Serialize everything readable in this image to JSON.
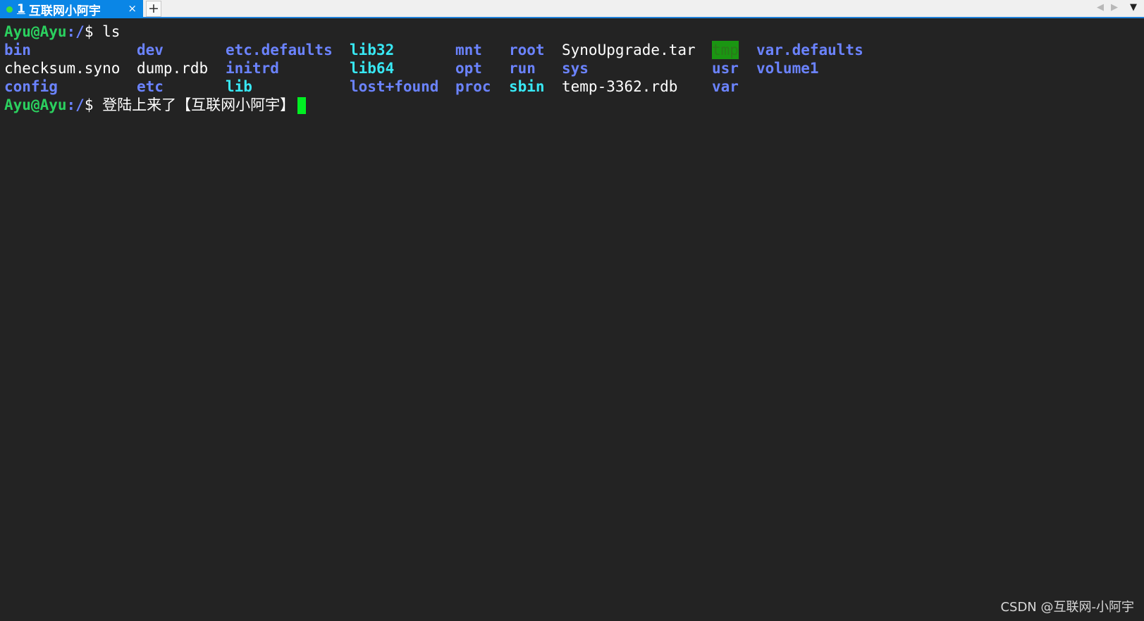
{
  "tab": {
    "number": "1",
    "title": "互联网小阿宇",
    "close_glyph": "×",
    "status_color": "#3ee03e"
  },
  "tabbar": {
    "new_tab_glyph": "+",
    "scroll_left_glyph": "◀",
    "scroll_right_glyph": "▶",
    "menu_glyph": "▼"
  },
  "terminal": {
    "prompt1": {
      "host": "Ayu@Ayu",
      "path": ":/",
      "symbol": "$ ",
      "command": "ls"
    },
    "ls_rows": [
      [
        "bin",
        "dev",
        "etc.defaults",
        "lib32",
        "mnt",
        "root",
        "SynoUpgrade.tar",
        "tmp",
        "var.defaults"
      ],
      [
        "checksum.syno",
        "dump.rdb",
        "initrd",
        "lib64",
        "opt",
        "run",
        "sys",
        "usr",
        "volume1"
      ],
      [
        "config",
        "etc",
        "lib",
        "lost+found",
        "proc",
        "sbin",
        "temp-3362.rdb",
        "var",
        ""
      ]
    ],
    "prompt2": {
      "host": "Ayu@Ayu",
      "path": ":/",
      "symbol": "$ ",
      "input": "登陆上来了【互联网小阿宇】"
    }
  },
  "colors": {
    "background": "#232323",
    "prompt_green": "#2bd15f",
    "directory_blue": "#6b83ff",
    "symlink_cyan": "#38e8f4",
    "cursor_green": "#00ee22"
  },
  "watermark": "CSDN @互联网-小阿宇"
}
